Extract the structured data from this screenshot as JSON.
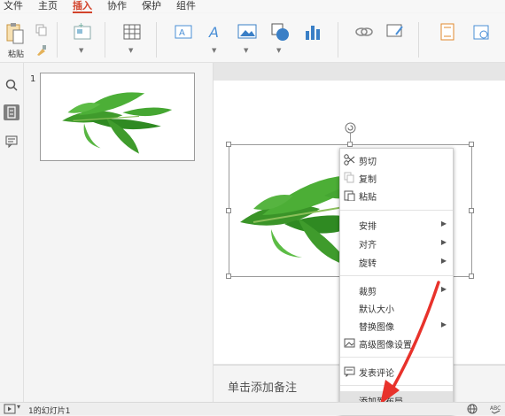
{
  "menu": {
    "items": [
      "文件",
      "主页",
      "插入",
      "协作",
      "保护",
      "组件"
    ],
    "active_index": 2,
    "accent_color": "#d2432b"
  },
  "ribbon": {
    "paste_label": "粘贴",
    "icons": [
      "paste-icon",
      "copy-icon",
      "format-brush-icon",
      "new-slide-icon",
      "table-icon",
      "textbox-icon",
      "wordart-icon",
      "picture-icon",
      "shapes-icon",
      "chart-icon",
      "link-icon",
      "comment-icon",
      "header-footer-icon",
      "date-time-icon"
    ]
  },
  "sidebar": {
    "icons": [
      "search-icon",
      "slides-panel-icon",
      "comment-panel-icon"
    ],
    "active": "slides-panel-icon"
  },
  "slides": {
    "number": "1"
  },
  "notes": {
    "placeholder": "单击添加备注"
  },
  "context_menu": {
    "items": [
      {
        "label": "剪切",
        "icon": "scissors-icon"
      },
      {
        "label": "复制",
        "icon": "copy-icon"
      },
      {
        "label": "粘贴",
        "icon": "paste-icon"
      },
      {
        "label": "安排",
        "submenu": true
      },
      {
        "label": "对齐",
        "submenu": true
      },
      {
        "label": "旋转",
        "submenu": true
      },
      {
        "label": "裁剪",
        "submenu": true
      },
      {
        "label": "默认大小"
      },
      {
        "label": "替换图像",
        "submenu": true
      },
      {
        "label": "高级图像设置",
        "icon": "image-settings-icon"
      },
      {
        "label": "发表评论",
        "icon": "comment-icon"
      },
      {
        "label": "添加到布局",
        "highlighted": true
      }
    ]
  },
  "status": {
    "slide_info": "1的幻灯片1"
  },
  "annotation": {
    "arrow_color": "#e8322b"
  }
}
